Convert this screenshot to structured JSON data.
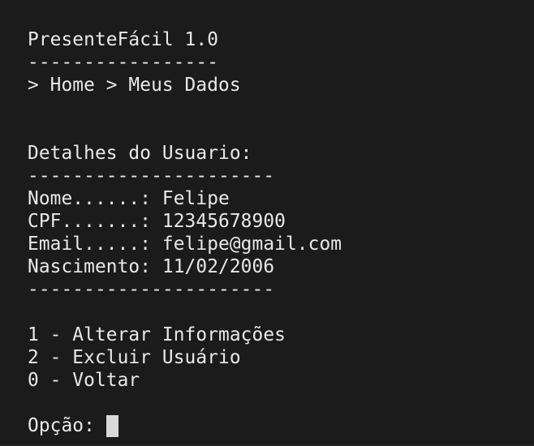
{
  "terminal": {
    "header": {
      "title": "PresenteFácil 1.0",
      "title_rule": "-----------------",
      "breadcrumb": "> Home > Meus Dados"
    },
    "details": {
      "heading": "Detalhes do Usuario:",
      "rule_top": "----------------------",
      "fields": [
        {
          "text": "Nome......: Felipe"
        },
        {
          "text": "CPF.......: 12345678900"
        },
        {
          "text": "Email.....: felipe@gmail.com"
        },
        {
          "text": "Nascimento: 11/02/2006"
        }
      ],
      "rule_bottom": "----------------------"
    },
    "menu": {
      "options": [
        {
          "text": "1 - Alterar Informações"
        },
        {
          "text": "2 - Excluir Usuário"
        },
        {
          "text": "0 - Voltar"
        }
      ]
    },
    "prompt": "Opção: "
  }
}
